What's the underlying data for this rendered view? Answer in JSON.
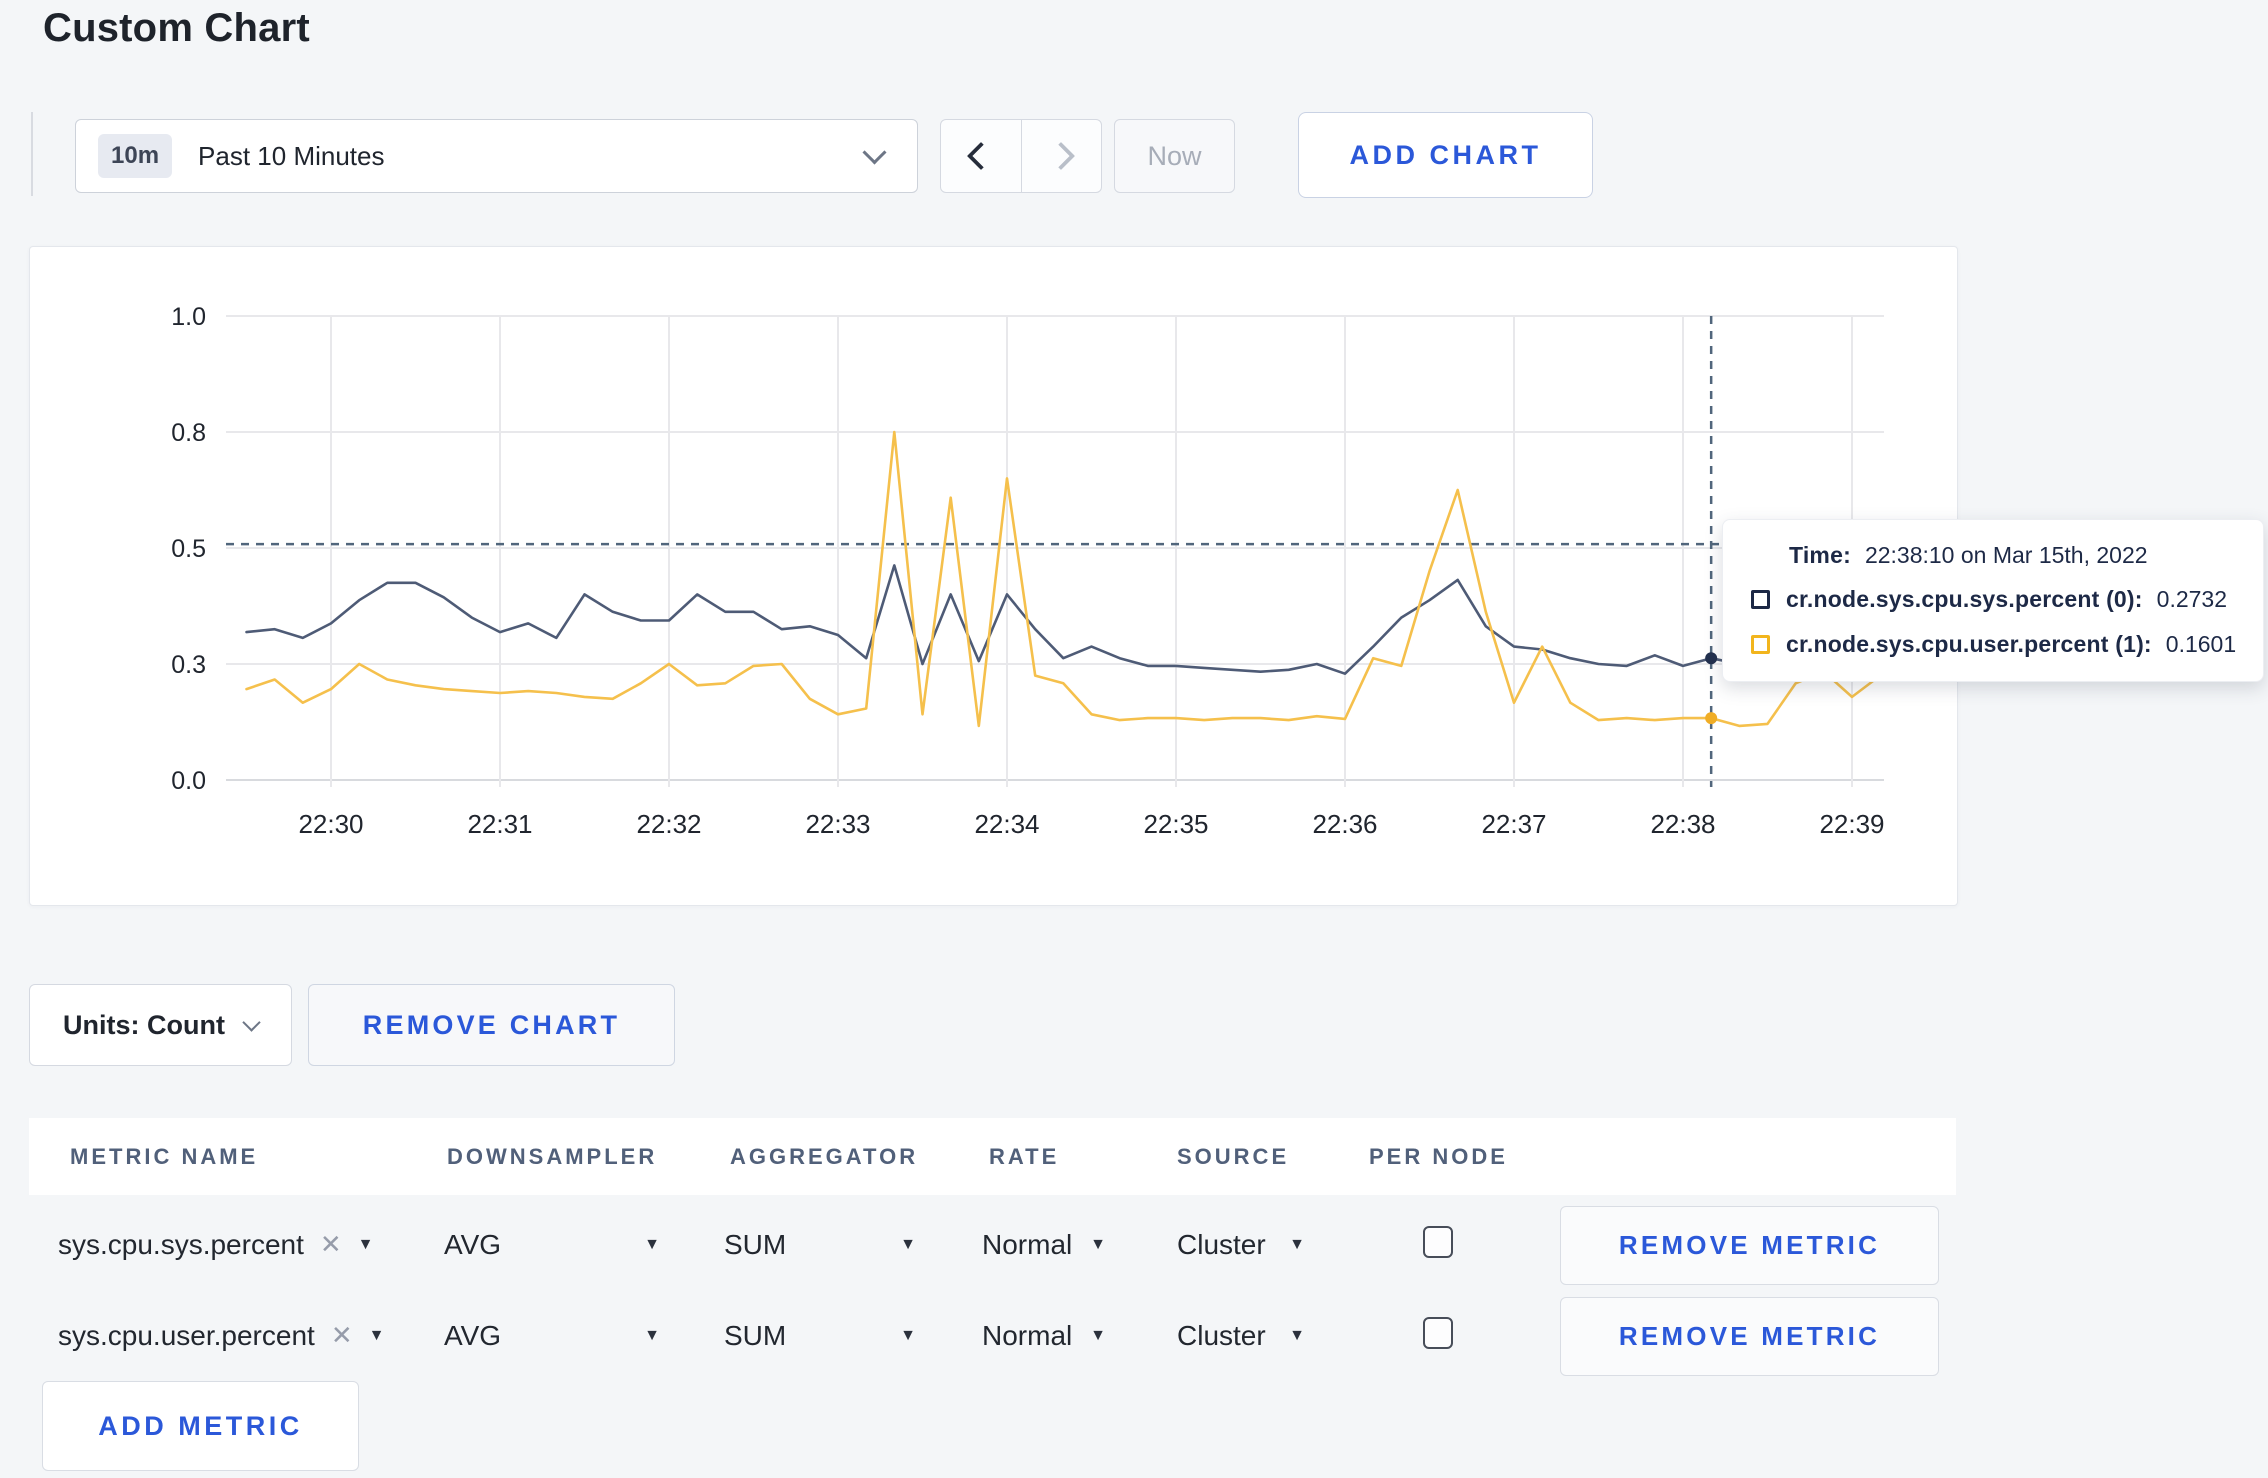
{
  "page": {
    "title": "Custom Chart",
    "background": "#f4f6f8",
    "accent_blue": "#2b58d9"
  },
  "toolbar": {
    "range_badge": "10m",
    "range_label": "Past 10 Minutes",
    "prev_icon": "chevron-left",
    "next_icon": "chevron-right",
    "now_label": "Now",
    "add_chart_label": "ADD CHART"
  },
  "chart_data": {
    "type": "line",
    "title": "",
    "xlabel": "",
    "ylabel": "",
    "ylim": [
      0.0,
      1.0
    ],
    "grid": true,
    "legend_position": "tooltip",
    "x_tick_labels": [
      "22:30",
      "22:31",
      "22:32",
      "22:33",
      "22:34",
      "22:35",
      "22:36",
      "22:37",
      "22:38",
      "22:39"
    ],
    "y_tick_labels": [
      "1.0",
      "0.8",
      "0.5",
      "0.3",
      "0.0"
    ],
    "y_tick_values": [
      1.0,
      0.8,
      0.5,
      0.3,
      0.0
    ],
    "x_start_time": "22:29:30",
    "x_step_seconds": 10,
    "series": [
      {
        "name": "cr.node.sys.cpu.sys.percent",
        "color": "#4e5b76",
        "marker_color": "#22304e",
        "values": [
          0.355,
          0.36,
          0.345,
          0.37,
          0.41,
          0.44,
          0.44,
          0.415,
          0.38,
          0.355,
          0.37,
          0.345,
          0.42,
          0.39,
          0.375,
          0.375,
          0.42,
          0.39,
          0.39,
          0.36,
          0.365,
          0.35,
          0.31,
          0.47,
          0.3,
          0.42,
          0.305,
          0.42,
          0.36,
          0.31,
          0.33,
          0.31,
          0.295,
          0.295,
          0.29,
          0.285,
          0.28,
          0.285,
          0.3,
          0.275,
          0.33,
          0.38,
          0.41,
          0.445,
          0.365,
          0.33,
          0.325,
          0.31,
          0.3,
          0.295,
          0.315,
          0.295,
          0.31,
          0.3,
          0.3,
          0.31,
          0.3,
          0.295,
          0.3
        ]
      },
      {
        "name": "cr.node.sys.cpu.user.percent",
        "color": "#f5c04c",
        "marker_color": "#f0ad26",
        "values": [
          0.235,
          0.26,
          0.2,
          0.235,
          0.3,
          0.26,
          0.245,
          0.235,
          0.23,
          0.225,
          0.23,
          0.225,
          0.215,
          0.21,
          0.25,
          0.3,
          0.245,
          0.25,
          0.295,
          0.3,
          0.21,
          0.17,
          0.185,
          0.8,
          0.17,
          0.63,
          0.14,
          0.68,
          0.27,
          0.25,
          0.17,
          0.155,
          0.16,
          0.16,
          0.155,
          0.16,
          0.16,
          0.155,
          0.165,
          0.158,
          0.31,
          0.295,
          0.46,
          0.65,
          0.39,
          0.2,
          0.33,
          0.2,
          0.155,
          0.16,
          0.155,
          0.16,
          0.16,
          0.14,
          0.145,
          0.25,
          0.28,
          0.215,
          0.27
        ]
      }
    ],
    "crosshair": {
      "index": 52,
      "time": "22:38:10",
      "hover_value": 0.51,
      "color": "#51667c"
    },
    "gridline_color": "#e8e8eb",
    "baseline_color": "#d8dade"
  },
  "tooltip": {
    "time_label": "Time:",
    "time_value": "22:38:10 on Mar 15th, 2022",
    "rows": [
      {
        "label": "cr.node.sys.cpu.sys.percent (0):",
        "value": "0.2732",
        "color": "#1c2845"
      },
      {
        "label": "cr.node.sys.cpu.user.percent (1):",
        "value": "0.1601",
        "color": "#f2b51d"
      }
    ]
  },
  "chart_controls": {
    "units_label": "Units: Count",
    "remove_chart_label": "REMOVE CHART"
  },
  "metrics_table": {
    "headers": [
      "METRIC NAME",
      "DOWNSAMPLER",
      "AGGREGATOR",
      "RATE",
      "SOURCE",
      "PER NODE"
    ],
    "rows": [
      {
        "metric": "sys.cpu.sys.percent",
        "remove_icon": "✕",
        "downsampler": "AVG",
        "aggregator": "SUM",
        "rate": "Normal",
        "source": "Cluster",
        "per_node_checked": false,
        "remove_label": "REMOVE METRIC"
      },
      {
        "metric": "sys.cpu.user.percent",
        "remove_icon": "✕",
        "downsampler": "AVG",
        "aggregator": "SUM",
        "rate": "Normal",
        "source": "Cluster",
        "per_node_checked": false,
        "remove_label": "REMOVE METRIC"
      }
    ],
    "add_metric_label": "ADD METRIC"
  }
}
